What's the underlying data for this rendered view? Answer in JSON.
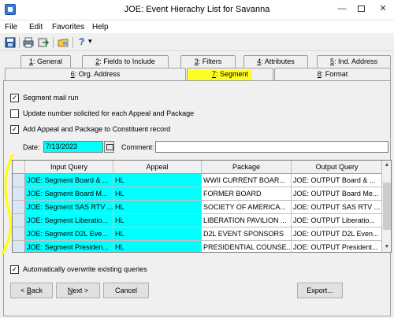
{
  "window": {
    "title": "JOE: Event Hierachy List for Savanna",
    "min": "—",
    "close": "✕"
  },
  "menu": [
    "File",
    "Edit",
    "Favorites",
    "Help"
  ],
  "toolbar": {
    "help_glyph": "?",
    "dropdown_glyph": "▾"
  },
  "tabs_row1": [
    {
      "num": "1",
      "label": ": General"
    },
    {
      "num": "2",
      "label": ": Fields to Include"
    },
    {
      "num": "3",
      "label": ": Filters"
    },
    {
      "num": "4",
      "label": ": Attributes"
    },
    {
      "num": "5",
      "label": ": Ind. Address"
    }
  ],
  "tabs_row2": [
    {
      "num": "6",
      "label": ": Org. Address"
    },
    {
      "num": "7",
      "label": ": Segment"
    },
    {
      "num": "8",
      "label": ": Format"
    }
  ],
  "options": {
    "segment_mail_run": "Segment mail run",
    "update_number": "Update number solicited for each Appeal and Package",
    "add_to_constituent": "Add Appeal and Package to Constituent record",
    "auto_overwrite": "Automatically overwrite existing queries"
  },
  "checks": {
    "segment_mail_run": "✓",
    "update_number": "",
    "add_to_constituent": "✓",
    "auto_overwrite": "✓"
  },
  "date": {
    "label": "Date:",
    "value": "7/13/2023"
  },
  "comment": {
    "label": "Comment:",
    "value": ""
  },
  "grid": {
    "headers": [
      "Input Query",
      "Appeal",
      "Package",
      "Output Query"
    ],
    "rows": [
      [
        "JOE: Segment Board & ...",
        "HL",
        "WWII CURRENT BOAR...",
        "JOE: OUTPUT Board & ..."
      ],
      [
        "JOE: Segment Board M...",
        "HL",
        "FORMER BOARD",
        "JOE: OUTPUT Board Me..."
      ],
      [
        "JOE: Segment SAS RTV ...",
        "HL",
        "SOCIETY OF AMERICA...",
        "JOE: OUTPUT SAS RTV ..."
      ],
      [
        "JOE: Segment Liberatio...",
        "HL",
        "LIBERATION PAVILION ...",
        "JOE: OUTPUT Liberatio..."
      ],
      [
        "JOE: Segment D2L Eve...",
        "HL",
        "D2L EVENT SPONSORS",
        "JOE: OUTPUT D2L Even..."
      ],
      [
        "JOE: Segment Presiden...",
        "HL",
        "PRESIDENTIAL COUNSE...",
        "JOE: OUTPUT President..."
      ]
    ]
  },
  "buttons": {
    "back": "Back",
    "back_key": "B",
    "next": "Next >",
    "next_key": "N",
    "cancel": "Cancel",
    "export": "Export..."
  },
  "colors": {
    "highlight": "#00ffff",
    "annotation": "#ffff00"
  }
}
